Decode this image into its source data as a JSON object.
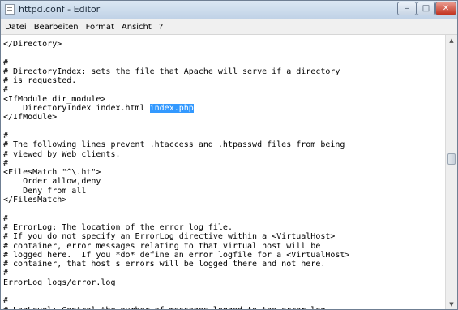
{
  "window": {
    "title": "httpd.conf - Editor"
  },
  "controls": {
    "minimize": "–",
    "maximize": "□",
    "close": "✕"
  },
  "menu": [
    "Datei",
    "Bearbeiten",
    "Format",
    "Ansicht",
    "?"
  ],
  "editor": {
    "before_selection": "</Directory>\n\n#\n# DirectoryIndex: sets the file that Apache will serve if a directory\n# is requested.\n#\n<IfModule dir_module>\n    DirectoryIndex index.html ",
    "selected_text": "index.php",
    "after_selection": "\n</IfModule>\n\n#\n# The following lines prevent .htaccess and .htpasswd files from being\n# viewed by Web clients.\n#\n<FilesMatch \"^\\.ht\">\n    Order allow,deny\n    Deny from all\n</FilesMatch>\n\n#\n# ErrorLog: The location of the error log file.\n# If you do not specify an ErrorLog directive within a <VirtualHost>\n# container, error messages relating to that virtual host will be\n# logged here.  If you *do* define an error logfile for a <VirtualHost>\n# container, that host's errors will be logged there and not here.\n#\nErrorLog logs/error.log\n\n#\n# LogLevel: Control the number of messages logged to the error_log.\n# Possible values include: debug, info, notice, warn, error, crit,"
  },
  "scrollbar": {
    "up_arrow": "▲",
    "down_arrow": "▼"
  },
  "colors": {
    "selection": "#3399ff",
    "close_button": "#c2321f",
    "titlebar": "#c0d2e6"
  }
}
